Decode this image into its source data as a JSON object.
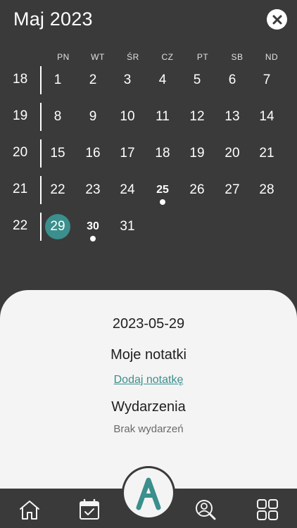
{
  "header": {
    "month_title": "Maj 2023"
  },
  "weekdays": [
    "PN",
    "WT",
    "ŚR",
    "CZ",
    "PT",
    "SB",
    "ND"
  ],
  "weeks": [
    {
      "week": "18",
      "days": [
        "1",
        "2",
        "3",
        "4",
        "5",
        "6",
        "7"
      ]
    },
    {
      "week": "19",
      "days": [
        "8",
        "9",
        "10",
        "11",
        "12",
        "13",
        "14"
      ]
    },
    {
      "week": "20",
      "days": [
        "15",
        "16",
        "17",
        "18",
        "19",
        "20",
        "21"
      ]
    },
    {
      "week": "21",
      "days": [
        "22",
        "23",
        "24",
        "25",
        "26",
        "27",
        "28"
      ]
    },
    {
      "week": "22",
      "days": [
        "29",
        "30",
        "31",
        "",
        "",
        "",
        ""
      ]
    }
  ],
  "selected_day": "29",
  "event_days": [
    "25",
    "30"
  ],
  "sheet": {
    "date": "2023-05-29",
    "notes_title": "Moje notatki",
    "add_note": "Dodaj notatkę",
    "events_title": "Wydarzenia",
    "no_events": "Brak wydarzeń"
  },
  "colors": {
    "accent": "#3b8f8c",
    "background": "#3a3a3a",
    "sheet": "#f4f4f4"
  },
  "nav": {
    "items": [
      "home-icon",
      "calendar-check-icon",
      "app-logo-icon",
      "user-search-icon",
      "grid-icon"
    ],
    "active": "calendar-check-icon"
  }
}
